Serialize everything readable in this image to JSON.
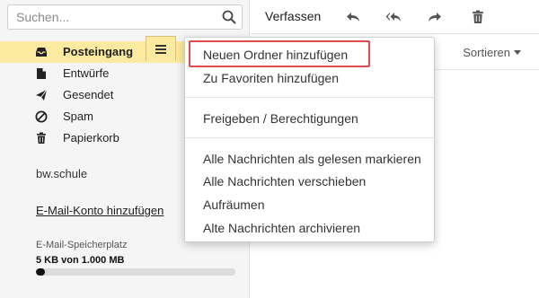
{
  "search": {
    "placeholder": "Suchen..."
  },
  "toolbar": {
    "compose_label": "Verfassen",
    "icons": [
      "reply-icon",
      "reply-all-icon",
      "forward-icon",
      "trash-icon"
    ]
  },
  "folders": [
    {
      "label": "Posteingang",
      "icon": "inbox-icon",
      "active": true
    },
    {
      "label": "Entwürfe",
      "icon": "draft-icon"
    },
    {
      "label": "Gesendet",
      "icon": "send-icon"
    },
    {
      "label": "Spam",
      "icon": "spam-icon"
    },
    {
      "label": "Papierkorb",
      "icon": "trash-icon"
    }
  ],
  "account": {
    "name": "bw.schule",
    "add_label": "E-Mail-Konto hinzufügen"
  },
  "storage": {
    "label": "E-Mail-Speicherplatz",
    "value": "5 KB von 1.000 MB",
    "fill_percent": 0.0005
  },
  "list": {
    "sort_label": "Sortieren"
  },
  "menu": {
    "items": [
      "Neuen Ordner hinzufügen",
      "Zu Favoriten hinzufügen",
      "Freigeben / Berechtigungen",
      "Alle Nachrichten als gelesen markieren",
      "Alle Nachrichten verschieben",
      "Aufräumen",
      "Alte Nachrichten archivieren"
    ]
  },
  "colors": {
    "active_folder_bg": "#fbeaa0",
    "highlight_border": "#e34a4a"
  }
}
